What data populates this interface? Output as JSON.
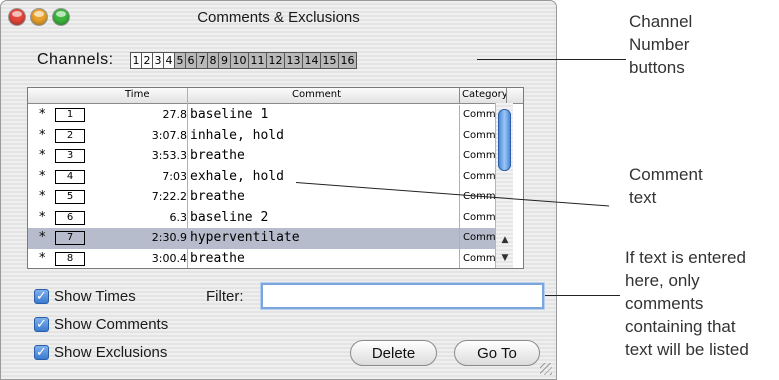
{
  "window": {
    "title": "Comments & Exclusions"
  },
  "channels": {
    "label": "Channels:",
    "buttons": [
      "1",
      "2",
      "3",
      "4",
      "5",
      "6",
      "7",
      "8",
      "9",
      "10",
      "11",
      "12",
      "13",
      "14",
      "15",
      "16"
    ],
    "selected_from": 5
  },
  "table": {
    "headers": {
      "time": "Time",
      "comment": "Comment",
      "category": "Category"
    },
    "rows": [
      {
        "marker": "*",
        "num": "1",
        "time": "27.8",
        "comment": "baseline 1",
        "category": "Comment"
      },
      {
        "marker": "*",
        "num": "2",
        "time": "3:07.8",
        "comment": "inhale, hold",
        "category": "Comment"
      },
      {
        "marker": "*",
        "num": "3",
        "time": "3:53.3",
        "comment": "breathe",
        "category": "Comment"
      },
      {
        "marker": "*",
        "num": "4",
        "time": "7:03",
        "comment": "exhale, hold",
        "category": "Comment"
      },
      {
        "marker": "*",
        "num": "5",
        "time": "7:22.2",
        "comment": "breathe",
        "category": "Comment"
      },
      {
        "marker": "*",
        "num": "6",
        "time": "6.3",
        "comment": "baseline 2",
        "category": "Comment"
      },
      {
        "marker": "*",
        "num": "7",
        "time": "2:30.9",
        "comment": "hyperventilate",
        "category": "Comment",
        "selected": true
      },
      {
        "marker": "*",
        "num": "8",
        "time": "3:00.4",
        "comment": "breathe",
        "category": "Comment"
      }
    ]
  },
  "options": {
    "show_times": "Show Times",
    "show_comments": "Show Comments",
    "show_exclusions": "Show Exclusions"
  },
  "filter": {
    "label": "Filter:",
    "value": ""
  },
  "buttons": {
    "delete": "Delete",
    "goto": "Go To"
  },
  "annotations": {
    "channel_buttons": [
      "Channel",
      "Number",
      "buttons"
    ],
    "comment_text": [
      "Comment",
      "text"
    ],
    "filter_note": [
      "If text is entered",
      "here, only",
      "comments",
      "containing that",
      "text will be listed"
    ]
  },
  "colors": {
    "selection": "#b6bccb",
    "accent": "#3b7bd1",
    "channel_on": "#b8b8b8"
  }
}
